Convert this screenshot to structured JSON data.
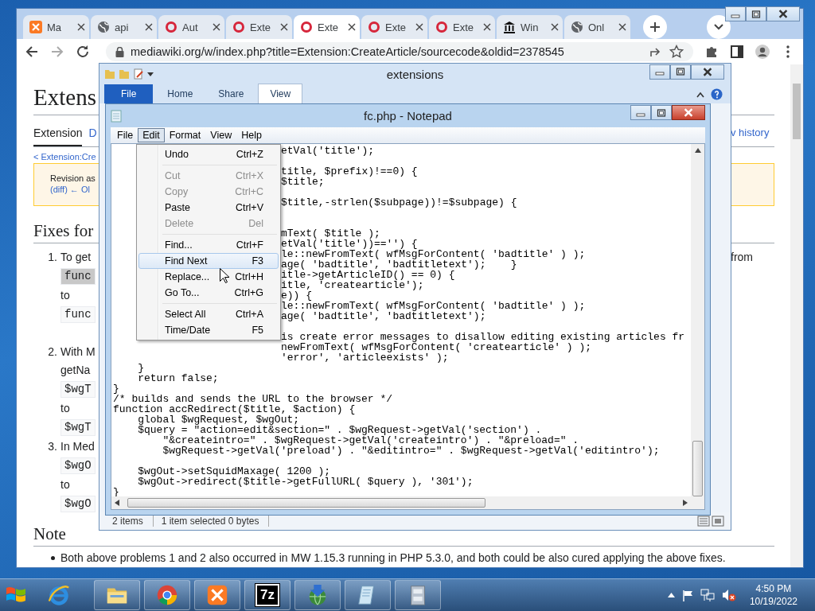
{
  "browser": {
    "tabs": [
      {
        "label": "Ma",
        "kind": "xampp",
        "selected": false
      },
      {
        "label": "api",
        "kind": "globe",
        "selected": false
      },
      {
        "label": "Aut",
        "kind": "ring",
        "selected": false
      },
      {
        "label": "Exte",
        "kind": "ring",
        "selected": false
      },
      {
        "label": "Exte",
        "kind": "ring",
        "selected": true
      },
      {
        "label": "Exte",
        "kind": "ring",
        "selected": false
      },
      {
        "label": "Exte",
        "kind": "ring",
        "selected": false
      },
      {
        "label": "Win",
        "kind": "museum",
        "selected": false
      },
      {
        "label": "Onl",
        "kind": "globe",
        "selected": false
      }
    ],
    "url": "mediawiki.org/w/index.php?title=Extension:CreateArticle/sourcecode&oldid=2378545"
  },
  "wiki": {
    "heading": "Extens",
    "tabs": [
      {
        "label": "Extension",
        "selected": true
      },
      {
        "label": "D",
        "selected": false
      }
    ],
    "right_tab": "v history",
    "breadcrumb": "< Extension:Cre",
    "notice": [
      "Revision as",
      "(diff) ← Ol"
    ],
    "section_heading": "Fixes for",
    "list": [
      {
        "number": "1.",
        "lines": [
          {
            "kind": "text",
            "text": "To get"
          },
          {
            "kind": "code",
            "text": "func",
            "highlighted": true
          },
          {
            "kind": "text",
            "text": "to"
          },
          {
            "kind": "code",
            "text": "func",
            "highlighted": false
          }
        ]
      },
      {
        "number": "2.",
        "lines": [
          {
            "kind": "text",
            "text": "With M"
          },
          {
            "kind": "text",
            "text": "getNa"
          },
          {
            "kind": "code",
            "text": "$wgT",
            "highlighted": false
          },
          {
            "kind": "text",
            "text": "to"
          },
          {
            "kind": "code",
            "text": "$wgT",
            "highlighted": false
          }
        ]
      },
      {
        "number": "3.",
        "lines": [
          {
            "kind": "text",
            "text": "In Med"
          },
          {
            "kind": "code",
            "text": "$wgO",
            "highlighted": false
          },
          {
            "kind": "text",
            "text": "to"
          },
          {
            "kind": "code",
            "text": "$wgO",
            "highlighted": false
          }
        ]
      }
    ],
    "right_text": "from",
    "note_heading": "Note",
    "note_items": [
      "Both above problems 1 and 2 also occurred in MW 1.15.3 running in PHP 5.3.0, and both could be also cured applying the above fixes."
    ]
  },
  "explorer": {
    "title": "extensions",
    "ribbon_tabs": [
      {
        "label": "File",
        "kind": "file",
        "selected": false
      },
      {
        "label": "Home",
        "kind": "tab",
        "selected": false
      },
      {
        "label": "Share",
        "kind": "tab",
        "selected": false
      },
      {
        "label": "View",
        "kind": "tab",
        "selected": true
      }
    ],
    "status": [
      "2 items",
      "1 item selected  0 bytes"
    ]
  },
  "notepad": {
    "title": "fc.php - Notepad",
    "menu": [
      {
        "label": "File",
        "selected": false
      },
      {
        "label": "Edit",
        "selected": true
      },
      {
        "label": "Format",
        "selected": false
      },
      {
        "label": "View",
        "selected": false
      },
      {
        "label": "Help",
        "selected": false
      }
    ],
    "lines_beside_menu": [
      {
        "kind": "code",
        "text": "etVal('title');"
      },
      {
        "kind": "blank"
      },
      {
        "kind": "code",
        "text": "title, $prefix)!==0) {"
      },
      {
        "kind": "code",
        "text": "$title;"
      },
      {
        "kind": "blank"
      },
      {
        "kind": "code",
        "text": "$title,-strlen($subpage))!=$subpage) {"
      },
      {
        "kind": "blank"
      },
      {
        "kind": "blank"
      },
      {
        "kind": "code",
        "text": "mText( $title );"
      },
      {
        "kind": "code",
        "text": "etVal('title'))=='') {"
      },
      {
        "kind": "code",
        "text": "le::newFromText( wfMsgForContent( 'badtitle' ) );"
      },
      {
        "kind": "code",
        "text": "age( 'badtitle', 'badtitletext');    }"
      },
      {
        "kind": "code",
        "text": "itle->getArticleID() == 0) {"
      },
      {
        "kind": "code",
        "text": "itle, 'createarticle');"
      },
      {
        "kind": "code",
        "text": "e)) {"
      },
      {
        "kind": "code",
        "text": "le::newFromText( wfMsgForContent( 'badtitle' ) );"
      },
      {
        "kind": "code",
        "text": "age( 'badtitle', 'badtitletext');"
      },
      {
        "kind": "blank"
      },
      {
        "kind": "code",
        "text": "is create error messages to disallow editing existing articles fr"
      },
      {
        "kind": "code",
        "text": "newFromText( wfMsgForContent( 'createarticle' ) );"
      },
      {
        "kind": "code",
        "text": "'error', 'articleexists' );"
      }
    ],
    "lines": [
      {
        "kind": "code",
        "text": "    }"
      },
      {
        "kind": "code",
        "text": "    return false;"
      },
      {
        "kind": "code",
        "text": "}"
      },
      {
        "kind": "code",
        "text": "/* builds and sends the URL to the browser */"
      },
      {
        "kind": "code",
        "text": "function accRedirect($title, $action) {"
      },
      {
        "kind": "code",
        "text": "    global $wgRequest, $wgOut;"
      },
      {
        "kind": "code",
        "text": "    $query = \"action=edit&section=\" . $wgRequest->getVal('section') ."
      },
      {
        "kind": "code",
        "text": "        \"&createintro=\" . $wgRequest->getVal('createintro') . \"&preload=\" ."
      },
      {
        "kind": "code",
        "text": "        $wgRequest->getVal('preload') . \"&editintro=\" . $wgRequest->getVal('editintro');"
      },
      {
        "kind": "blank"
      },
      {
        "kind": "code",
        "text": "    $wgOut->setSquidMaxage( 1200 );"
      },
      {
        "kind": "code",
        "text": "    $wgOut->redirect($title->getFullURL( $query ), '301');"
      },
      {
        "kind": "code",
        "text": "}"
      }
    ],
    "edit_menu": [
      {
        "kind": "item",
        "label": "Undo",
        "shortcut": "Ctrl+Z",
        "disabled": false,
        "selected": false
      },
      {
        "kind": "separator"
      },
      {
        "kind": "item",
        "label": "Cut",
        "shortcut": "Ctrl+X",
        "disabled": true,
        "selected": false
      },
      {
        "kind": "item",
        "label": "Copy",
        "shortcut": "Ctrl+C",
        "disabled": true,
        "selected": false
      },
      {
        "kind": "item",
        "label": "Paste",
        "shortcut": "Ctrl+V",
        "disabled": false,
        "selected": false
      },
      {
        "kind": "item",
        "label": "Delete",
        "shortcut": "Del",
        "disabled": true,
        "selected": false
      },
      {
        "kind": "separator"
      },
      {
        "kind": "item",
        "label": "Find...",
        "shortcut": "Ctrl+F",
        "disabled": false,
        "selected": false
      },
      {
        "kind": "item",
        "label": "Find Next",
        "shortcut": "F3",
        "disabled": false,
        "selected": true
      },
      {
        "kind": "item",
        "label": "Replace...",
        "shortcut": "Ctrl+H",
        "disabled": false,
        "selected": false
      },
      {
        "kind": "item",
        "label": "Go To...",
        "shortcut": "Ctrl+G",
        "disabled": false,
        "selected": false
      },
      {
        "kind": "separator"
      },
      {
        "kind": "item",
        "label": "Select All",
        "shortcut": "Ctrl+A",
        "disabled": false,
        "selected": false
      },
      {
        "kind": "item",
        "label": "Time/Date",
        "shortcut": "F5",
        "disabled": false,
        "selected": false
      }
    ]
  },
  "taskbar": {
    "apps": [
      {
        "kind": "ie"
      },
      {
        "kind": "folder"
      },
      {
        "kind": "chrome"
      },
      {
        "kind": "xampp"
      },
      {
        "kind": "sevenzip",
        "label": "7z"
      },
      {
        "kind": "idm"
      },
      {
        "kind": "notepad"
      },
      {
        "kind": "archive"
      }
    ],
    "time": "4:50 PM",
    "date": "10/19/2022"
  }
}
